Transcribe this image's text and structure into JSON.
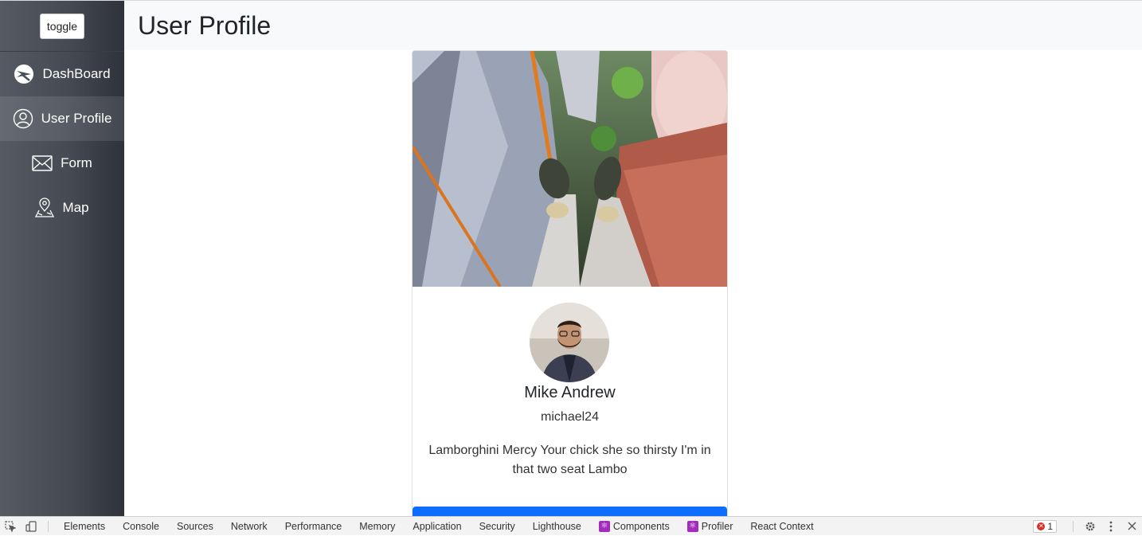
{
  "sidebar": {
    "toggle_label": "toggle",
    "items": [
      {
        "label": "DashBoard",
        "icon": "dashboard-icon",
        "active": false
      },
      {
        "label": "User Profile",
        "icon": "user-circle-icon",
        "active": true
      },
      {
        "label": "Form",
        "icon": "envelope-icon",
        "active": false
      },
      {
        "label": "Map",
        "icon": "map-pin-icon",
        "active": false
      }
    ]
  },
  "header": {
    "title": "User Profile"
  },
  "profile": {
    "name": "Mike Andrew",
    "username": "michael24",
    "bio": "Lamborghini Mercy Your chick she so thirsty I'm in that two seat Lambo"
  },
  "devtools": {
    "tabs": [
      "Elements",
      "Console",
      "Sources",
      "Network",
      "Performance",
      "Memory",
      "Application",
      "Security",
      "Lighthouse",
      "Components",
      "Profiler",
      "React Context"
    ],
    "error_count": "1"
  },
  "colors": {
    "primary": "#0d6efd",
    "sidebar_dark": "#2f323b",
    "header_bg": "#f8f9fa"
  }
}
